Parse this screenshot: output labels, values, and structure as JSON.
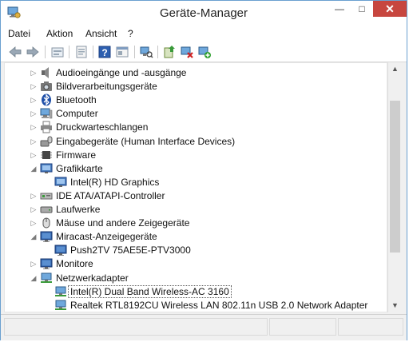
{
  "window": {
    "title": "Geräte-Manager"
  },
  "menu": [
    "Datei",
    "Aktion",
    "Ansicht",
    "?"
  ],
  "toolbar": {
    "buttons": [
      "back-icon",
      "forward-icon",
      "up-icon",
      "properties-icon",
      "help-icon",
      "show-hide-icon",
      "scan-hardware-icon",
      "update-driver-icon",
      "uninstall-icon",
      "enable-device-icon"
    ]
  },
  "tree": {
    "rows": [
      {
        "label": "Audioeingänge und -ausgänge",
        "icon": "speaker-icon",
        "state": "collapsed"
      },
      {
        "label": "Bildverarbeitungsgeräte",
        "icon": "camera-icon",
        "state": "collapsed"
      },
      {
        "label": "Bluetooth",
        "icon": "bluetooth-icon",
        "state": "collapsed"
      },
      {
        "label": "Computer",
        "icon": "computer-icon",
        "state": "collapsed"
      },
      {
        "label": "Druckwarteschlangen",
        "icon": "printer-icon",
        "state": "collapsed"
      },
      {
        "label": "Eingabegeräte (Human Interface Devices)",
        "icon": "hid-icon",
        "state": "collapsed"
      },
      {
        "label": "Firmware",
        "icon": "firmware-icon",
        "state": "collapsed"
      },
      {
        "label": "Grafikkarte",
        "icon": "display-adapter-icon",
        "state": "expanded"
      },
      {
        "label": "Intel(R) HD Graphics",
        "icon": "display-adapter-icon",
        "state": "child"
      },
      {
        "label": "IDE ATA/ATAPI-Controller",
        "icon": "ide-icon",
        "state": "collapsed"
      },
      {
        "label": "Laufwerke",
        "icon": "disk-icon",
        "state": "collapsed"
      },
      {
        "label": "Mäuse und andere Zeigegeräte",
        "icon": "mouse-icon",
        "state": "collapsed"
      },
      {
        "label": "Miracast-Anzeigegeräte",
        "icon": "monitor-icon",
        "state": "expanded"
      },
      {
        "label": "Push2TV 75AE5E-PTV3000",
        "icon": "monitor-icon",
        "state": "child"
      },
      {
        "label": "Monitore",
        "icon": "monitor-icon",
        "state": "collapsed"
      },
      {
        "label": "Netzwerkadapter",
        "icon": "network-icon",
        "state": "expanded"
      },
      {
        "label": "Intel(R) Dual Band Wireless-AC 3160",
        "icon": "network-icon",
        "state": "child-selected"
      },
      {
        "label": "Realtek RTL8192CU Wireless LAN 802.11n USB 2.0 Network Adapter",
        "icon": "network-icon",
        "state": "child"
      }
    ]
  },
  "colors": {
    "close_button": "#c7463f",
    "window_border": "#6aa0d0",
    "chrome": "#f0f0f0"
  }
}
